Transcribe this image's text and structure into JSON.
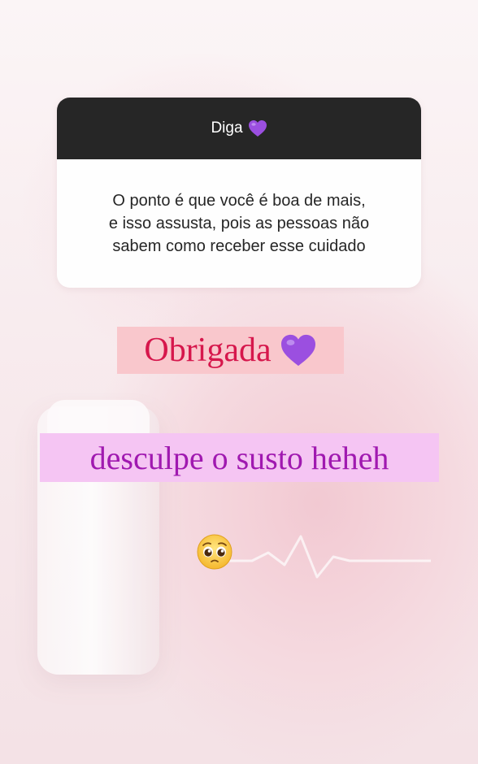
{
  "question_box": {
    "prompt": "Diga",
    "prompt_emoji": "purple-heart",
    "response_lines": [
      "O ponto é que você é boa de mais,",
      "e isso assusta, pois as pessoas não",
      "sabem como receber esse cuidado"
    ]
  },
  "stickers": {
    "thanks_text": "Obrigada",
    "thanks_emoji": "purple-heart",
    "sorry_text": "desculpe o susto heheh",
    "reaction_emoji": "pleading-face"
  },
  "colors": {
    "header_bg": "#262626",
    "thanks_bg": "#f9c7cc",
    "thanks_text": "#d6174c",
    "sorry_bg": "#f5c5f3",
    "sorry_text": "#a019b0",
    "heart": "#9b4fe0"
  }
}
